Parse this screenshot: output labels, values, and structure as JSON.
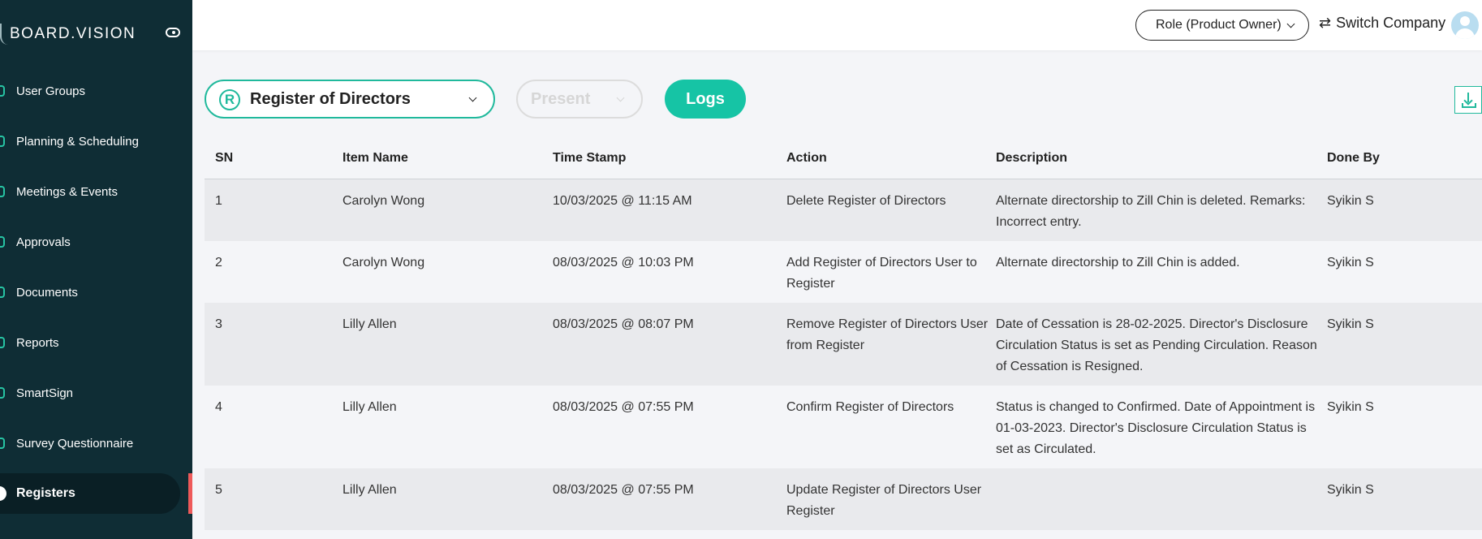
{
  "sidebar": {
    "logo": "BOARD.VISION",
    "items": [
      {
        "label": "User Groups"
      },
      {
        "label": "Planning & Scheduling"
      },
      {
        "label": "Meetings & Events"
      },
      {
        "label": "Approvals"
      },
      {
        "label": "Documents"
      },
      {
        "label": "Reports"
      },
      {
        "label": "SmartSign"
      },
      {
        "label": "Survey Questionnaire"
      },
      {
        "label": "Registers"
      }
    ],
    "active_item": "Registers",
    "accent_color": "#27c4a4",
    "active_marker_color": "#ee5a5a"
  },
  "header": {
    "role": "Role (Product Owner)",
    "switch_company": "Switch Company"
  },
  "controls": {
    "register_icon": "R",
    "register_select": "Register of Directors",
    "present_select": "Present",
    "logs_button": "Logs"
  },
  "table": {
    "columns": [
      "SN",
      "Item Name",
      "Time Stamp",
      "Action",
      "Description",
      "Done By"
    ],
    "rows": [
      {
        "sn": "1",
        "item": "Carolyn Wong",
        "time": "10/03/2025 @ 11:15 AM",
        "action": "Delete Register of Directors",
        "description": "Alternate directorship to Zill Chin is deleted. Remarks: Incorrect entry.",
        "by": "Syikin S"
      },
      {
        "sn": "2",
        "item": "Carolyn Wong",
        "time": "08/03/2025 @ 10:03 PM",
        "action": "Add Register of Directors User to Register",
        "description": "Alternate directorship to Zill Chin is added.",
        "by": "Syikin S"
      },
      {
        "sn": "3",
        "item": "Lilly Allen",
        "time": "08/03/2025 @ 08:07 PM",
        "action": "Remove Register of Directors User from Register",
        "description": "Date of Cessation is 28-02-2025. Director's Disclosure Circulation Status is set as Pending Circulation. Reason of Cessation is Resigned.",
        "by": "Syikin S"
      },
      {
        "sn": "4",
        "item": "Lilly Allen",
        "time": "08/03/2025 @ 07:55 PM",
        "action": "Confirm Register of Directors",
        "description": "Status is changed to Confirmed. Date of Appointment is 01-03-2023. Director's Disclosure Circulation Status is set as Circulated.",
        "by": "Syikin S"
      },
      {
        "sn": "5",
        "item": "Lilly Allen",
        "time": "08/03/2025 @ 07:55 PM",
        "action": "Update Register of Directors User Register",
        "description": "",
        "by": "Syikin S"
      }
    ]
  },
  "colors": {
    "sidebar_bg": "#0f2d35",
    "primary": "#16c4a5"
  }
}
